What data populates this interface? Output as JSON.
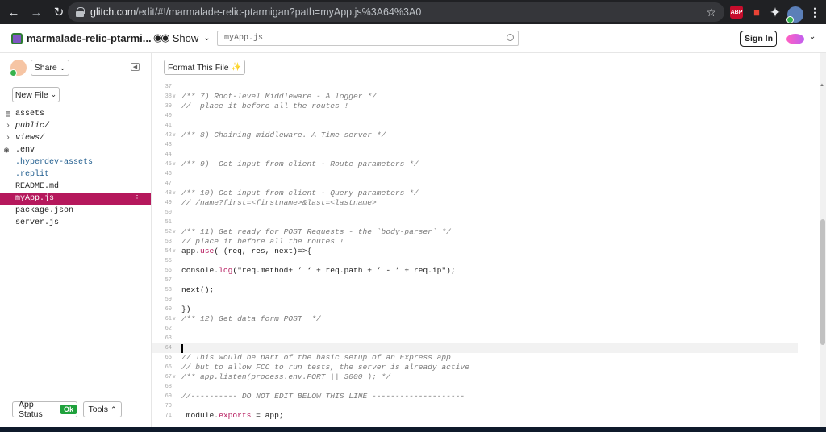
{
  "browser": {
    "url_host": "glitch.com",
    "url_path": "/edit/#!/marmalade-relic-ptarmigan?path=myApp.js%3A64%3A0",
    "ext_abp": "ABP"
  },
  "header": {
    "project_name": "marmalade-relic-ptarmi...",
    "show_label": "Show",
    "search_value": "myApp.js",
    "sign_in_label": "Sign In"
  },
  "sidebar": {
    "share_label": "Share",
    "new_file_label": "New File",
    "files": [
      {
        "name": "assets"
      },
      {
        "name": "public/"
      },
      {
        "name": "views/"
      },
      {
        "name": ".env"
      },
      {
        "name": ".hyperdev-assets"
      },
      {
        "name": ".replit"
      },
      {
        "name": "README.md"
      },
      {
        "name": "myApp.js"
      },
      {
        "name": "package.json"
      },
      {
        "name": "server.js"
      }
    ],
    "app_status_label": "App Status",
    "app_status_value": "Ok",
    "tools_label": "Tools"
  },
  "editor": {
    "format_label": "Format This File",
    "lines": [
      {
        "n": "37",
        "text": ""
      },
      {
        "n": "38",
        "text": "/** 7) Root-level Middleware - A logger */"
      },
      {
        "n": "39",
        "text": "//  place it before all the routes !"
      },
      {
        "n": "40",
        "text": ""
      },
      {
        "n": "41",
        "text": ""
      },
      {
        "n": "42",
        "text": "/** 8) Chaining middleware. A Time server */"
      },
      {
        "n": "43",
        "text": ""
      },
      {
        "n": "44",
        "text": ""
      },
      {
        "n": "45",
        "text": "/** 9)  Get input from client - Route parameters */"
      },
      {
        "n": "46",
        "text": ""
      },
      {
        "n": "47",
        "text": ""
      },
      {
        "n": "48",
        "text": "/** 10) Get input from client - Query parameters */"
      },
      {
        "n": "49",
        "text": "// /name?first=<firstname>&last=<lastname>"
      },
      {
        "n": "50",
        "text": ""
      },
      {
        "n": "51",
        "text": ""
      },
      {
        "n": "52",
        "text": "/** 11) Get ready for POST Requests - the `body-parser` */"
      },
      {
        "n": "53",
        "text": "// place it before all the routes !"
      },
      {
        "n": "54",
        "text_a": "app.",
        "text_b": "use",
        "text_c": "( (req, res, next)=>{"
      },
      {
        "n": "55",
        "text": ""
      },
      {
        "n": "56",
        "text_a": "console.",
        "text_b": "log",
        "text_c": "(\"req.method+ ’ ‘ + req.path + ’ - ’ + req.ip\");"
      },
      {
        "n": "57",
        "text": ""
      },
      {
        "n": "58",
        "text": "next();"
      },
      {
        "n": "59",
        "text": ""
      },
      {
        "n": "60",
        "text": "})"
      },
      {
        "n": "61",
        "text": "/** 12) Get data form POST  */"
      },
      {
        "n": "62",
        "text": ""
      },
      {
        "n": "63",
        "text": ""
      },
      {
        "n": "64",
        "text": ""
      },
      {
        "n": "65",
        "text": "// This would be part of the basic setup of an Express app"
      },
      {
        "n": "66",
        "text": "// but to allow FCC to run tests, the server is already active"
      },
      {
        "n": "67",
        "text": "/** app.listen(process.env.PORT || 3000 ); */"
      },
      {
        "n": "68",
        "text": ""
      },
      {
        "n": "69",
        "text": "//---------- DO NOT EDIT BELOW THIS LINE --------------------"
      },
      {
        "n": "70",
        "text": ""
      },
      {
        "n": "71",
        "text_a": " module.",
        "text_b": "exports",
        "text_c": " = app;"
      }
    ]
  },
  "colors": {
    "active_file_bg": "#b5185c",
    "status_ok": "#1fa13c"
  }
}
